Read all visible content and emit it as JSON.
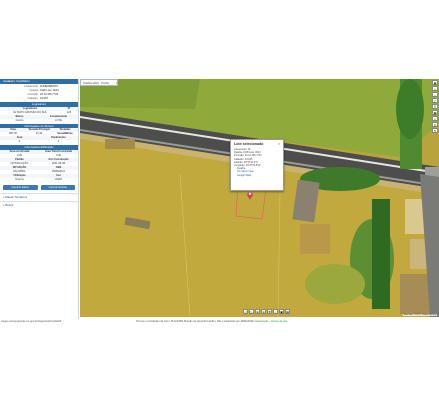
{
  "sidebar": {
    "header": "Cadastro Imobiliário",
    "fields": [
      {
        "k": "Loteamento",
        "v": "ZONEAMENTO"
      },
      {
        "k": "Quadra",
        "v": "0136  Lote: 0013"
      },
      {
        "k": "Inscrição",
        "v": "22.13.156.7743"
      },
      {
        "k": "Cadastro",
        "v": "43.615"
      }
    ],
    "logradouro_sec": "Logradouro",
    "logradouro_head": [
      "Logradouro",
      "Nº"
    ],
    "logradouro_row": [
      "AV MATO GROSSO DO SUL",
      "125"
    ],
    "compl_head": [
      "Bairro",
      "Complemento"
    ],
    "compl_row": [
      "Centro",
      "LOTE"
    ],
    "medidas_sec": "Informações do Terreno",
    "medidas_head": [
      "Área",
      "Testada Principal",
      "Testadas Secundárias"
    ],
    "medidas_row": [
      "387,00",
      "13,10",
      "0"
    ],
    "medidas_head2": [
      "Área",
      "Pavimentos"
    ],
    "medidas_row2": [
      "0",
      "0"
    ],
    "edif_sec": "Informações Edificação",
    "edif_head": [
      "Área construída",
      "Área Total Construída"
    ],
    "edif_row": [
      "0,00",
      "0,00"
    ],
    "edif_head2": [
      "Padrão",
      "Ano Construção"
    ],
    "edif_row2": [
      "NOTIFICAÇÃO",
      "2021-06-08"
    ],
    "edif_head3": [
      "SITUAÇÃO",
      "OBS"
    ],
    "edif_row3": [
      "EM OBRA",
      "25/06/2021"
    ],
    "edif_head4": [
      "Utilização",
      "Uso"
    ],
    "edif_row4": [
      "Terreno",
      "VAZIO"
    ],
    "btn_print": "Imprimir dados",
    "btn_report": "Imprimir Extrato",
    "acc1": "Mapas Temáticos",
    "acc2": "Busca"
  },
  "map": {
    "tab": "Ortofoto 2021 - Trecho",
    "tab_close": "×",
    "popup": {
      "title": "Lote selecionado",
      "close": "×",
      "lines": [
        "Loteamento: 01",
        "Quadra: 0136  Lote: 0013",
        "Inscrição: 22.13.156.7743",
        "Cadastro: 43.615",
        "Latitude: 20°27'24,4\"S",
        "Longitude: 54°37'51,8\"W"
      ],
      "links": [
        "Detalhe",
        "Ver Street View",
        "Google Maps"
      ]
    },
    "tools": [
      "◁",
      "▷",
      "⊕",
      "⊖",
      "✥",
      "⌂",
      "▣",
      "▤"
    ],
    "right_tools": [
      "◉",
      "+",
      "−",
      "⤢",
      "☰",
      "▦",
      "⌖",
      "◎",
      "✎"
    ],
    "attribution": "Map data ©2021 | Termos de uso"
  },
  "footer": {
    "url": "sisgeo.campogrande.ms.gov.br/sisgeo/web/mobile/#",
    "credits": "Termos e Condições de Uso / PLANURB Direção de Geoinformação | São | atualizado por SEMADUR",
    "links": "manutenção · termos de uso"
  },
  "colors": {
    "accent": "#2f6ea5",
    "road": "#4a4a4a",
    "ground": "#b9a33c"
  }
}
